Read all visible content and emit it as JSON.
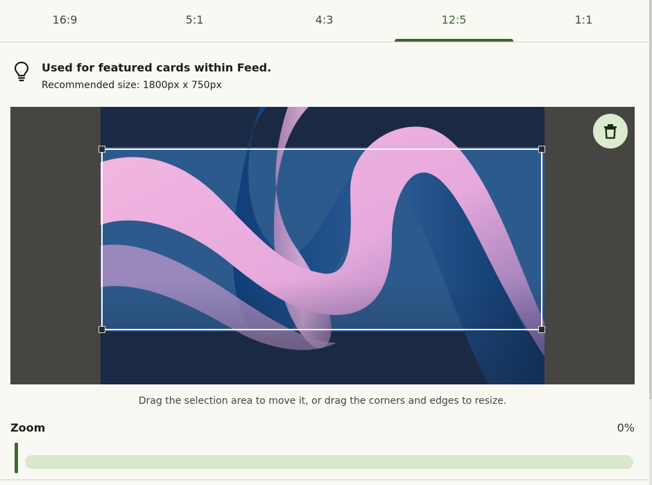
{
  "tabs": [
    {
      "label": "16:9",
      "active": false
    },
    {
      "label": "5:1",
      "active": false
    },
    {
      "label": "4:3",
      "active": false
    },
    {
      "label": "12:5",
      "active": true
    },
    {
      "label": "1:1",
      "active": false
    }
  ],
  "tip": {
    "icon": "lightbulb-icon",
    "title": "Used for featured cards within Feed.",
    "subtitle": "Recommended size: 1800px x 750px"
  },
  "crop": {
    "delete_icon": "trash-icon",
    "hint": "Drag the selection area to move it, or drag the corners and edges to resize."
  },
  "zoom": {
    "label": "Zoom",
    "value_text": "0%",
    "value": 0
  },
  "colors": {
    "accent": "#3b6a2e",
    "track": "#d9e7cd",
    "stage": "#454641"
  }
}
